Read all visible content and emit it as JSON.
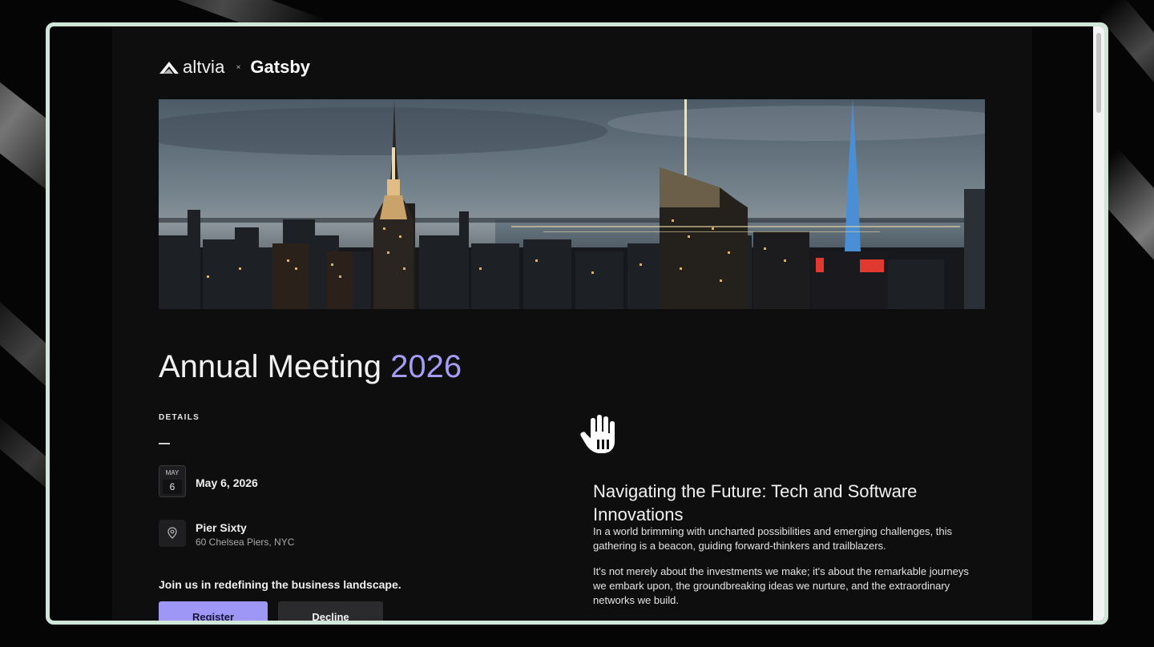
{
  "brand": {
    "primary_logo_text": "altvia",
    "separator": "×",
    "partner_logo_text": "Gatsby"
  },
  "banner": {
    "image_name": "city-skyline"
  },
  "title": {
    "main": "Annual Meeting ",
    "year": "2026",
    "year_color": "#a59cf3"
  },
  "details": {
    "label": "DETAILS",
    "calendar": {
      "month": "MAY",
      "day": "6"
    },
    "date": "May 6, 2026",
    "venue": {
      "name": "Pier Sixty",
      "address": "60 Chelsea Piers, NYC"
    },
    "invite_text": "Join us in redefining the business landscape."
  },
  "actions": {
    "register_label": "Register",
    "decline_label": "Decline",
    "register_color": "#9f97f5"
  },
  "content": {
    "heading": "Navigating the Future: Tech and Software Innovations",
    "paragraphs": [
      "In a world brimming with uncharted possibilities and emerging challenges, this gathering is a beacon, guiding forward-thinkers and trailblazers.",
      "It's not merely about the investments we make; it's about the remarkable journeys we embark upon, the groundbreaking ideas we nurture, and the extraordinary networks we build."
    ]
  },
  "colors": {
    "frame_border": "#cfe6d8",
    "page_background": "#0e0e0f"
  },
  "icons": {
    "cursor": "hand-cursor-icon",
    "location": "map-pin-icon",
    "calendar": "calendar-icon"
  }
}
